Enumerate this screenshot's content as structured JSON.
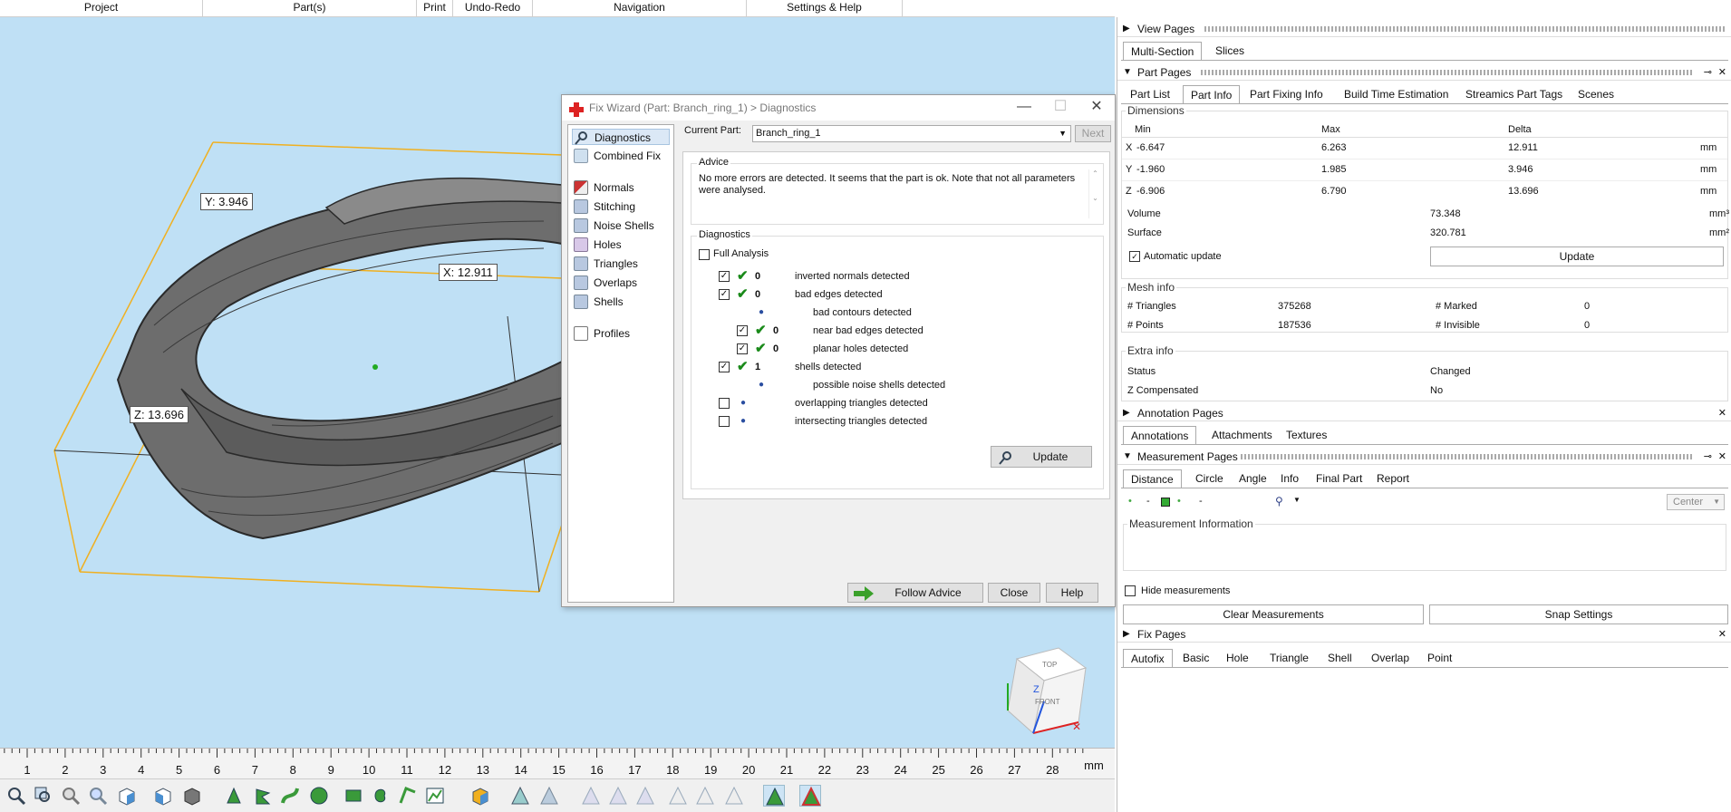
{
  "menubar": [
    "Project",
    "Part(s)",
    "Print",
    "Undo-Redo",
    "Navigation",
    "Settings & Help"
  ],
  "viewport": {
    "labels": {
      "y": "Y: 3.946",
      "x": "X: 12.911",
      "z": "Z: 13.696"
    },
    "cube": {
      "top": "TOP",
      "front": "FRONT",
      "axis": "Z"
    }
  },
  "ruler": {
    "ticks": [
      "1",
      "2",
      "3",
      "4",
      "5",
      "6",
      "7",
      "8",
      "9",
      "10",
      "11",
      "12",
      "13",
      "14",
      "15",
      "16",
      "17",
      "18",
      "19",
      "20",
      "21",
      "22",
      "23",
      "24",
      "25",
      "26",
      "27",
      "28"
    ],
    "unit": "mm"
  },
  "dialog": {
    "title": "Fix Wizard (Part: Branch_ring_1) > Diagnostics",
    "nav": {
      "diagnostics": "Diagnostics",
      "combined_fix": "Combined Fix",
      "normals": "Normals",
      "stitching": "Stitching",
      "noise_shells": "Noise Shells",
      "holes": "Holes",
      "triangles": "Triangles",
      "overlaps": "Overlaps",
      "shells": "Shells",
      "profiles": "Profiles"
    },
    "current_part_label": "Current Part:",
    "current_part_value": "Branch_ring_1",
    "next_button": "Next",
    "advice_title": "Advice",
    "advice_text": "No more errors are detected. It seems that the part is ok. Note that not all parameters were analysed.",
    "diagnostics_title": "Diagnostics",
    "full_analysis": "Full Analysis",
    "rows": {
      "inverted_normals": {
        "count": "0",
        "label": "inverted normals detected"
      },
      "bad_edges": {
        "count": "0",
        "label": "bad edges detected"
      },
      "bad_contours": {
        "label": "bad contours detected"
      },
      "near_bad_edges": {
        "count": "0",
        "label": "near bad edges detected"
      },
      "planar_holes": {
        "count": "0",
        "label": "planar holes detected"
      },
      "shells": {
        "count": "1",
        "label": "shells detected"
      },
      "noise_shells": {
        "label": "possible noise shells detected"
      },
      "overlapping": {
        "label": "overlapping triangles detected"
      },
      "intersecting": {
        "label": "intersecting triangles detected"
      }
    },
    "update_button": "Update",
    "follow_advice_button": "Follow Advice",
    "close_button": "Close",
    "help_button": "Help"
  },
  "panel": {
    "view_pages": {
      "title": "View Pages",
      "tabs": [
        "Multi-Section",
        "Slices"
      ]
    },
    "part_pages": {
      "title": "Part Pages",
      "tabs": [
        "Part List",
        "Part Info",
        "Part Fixing Info",
        "Build Time Estimation",
        "Streamics Part Tags",
        "Scenes"
      ]
    },
    "dimensions": {
      "title": "Dimensions",
      "headers": [
        "Min",
        "Max",
        "Delta"
      ],
      "x": {
        "axis": "X",
        "min": "-6.647",
        "max": "6.263",
        "delta": "12.911",
        "unit": "mm"
      },
      "y": {
        "axis": "Y",
        "min": "-1.960",
        "max": "1.985",
        "delta": "3.946",
        "unit": "mm"
      },
      "z": {
        "axis": "Z",
        "min": "-6.906",
        "max": "6.790",
        "delta": "13.696",
        "unit": "mm"
      },
      "volume": {
        "label": "Volume",
        "value": "73.348",
        "unit": "mm³"
      },
      "surface": {
        "label": "Surface",
        "value": "320.781",
        "unit": "mm²"
      },
      "automatic_update": "Automatic update",
      "update_button": "Update"
    },
    "mesh_info": {
      "title": "Mesh info",
      "triangles_label": "# Triangles",
      "triangles": "375268",
      "marked_label": "# Marked",
      "marked": "0",
      "points_label": "# Points",
      "points": "187536",
      "invisible_label": "# Invisible",
      "invisible": "0"
    },
    "extra_info": {
      "title": "Extra info",
      "status_label": "Status",
      "status": "Changed",
      "zcomp_label": "Z Compensated",
      "zcomp": "No"
    },
    "annotation_pages": {
      "title": "Annotation Pages",
      "tabs": [
        "Annotations",
        "Attachments",
        "Textures"
      ]
    },
    "measurement_pages": {
      "title": "Measurement Pages",
      "tabs": [
        "Distance",
        "Circle",
        "Angle",
        "Info",
        "Final Part",
        "Report"
      ],
      "center_select": "Center",
      "info_title": "Measurement Information",
      "hide_measurements": "Hide measurements",
      "clear_button": "Clear Measurements",
      "snap_button": "Snap Settings"
    },
    "fix_pages": {
      "title": "Fix Pages",
      "tabs": [
        "Autofix",
        "Basic",
        "Hole",
        "Triangle",
        "Shell",
        "Overlap",
        "Point"
      ]
    }
  },
  "colors": {
    "viewport_bg": "#bfe0f5",
    "bbox": "#f0b020",
    "check": "#1a8a1a",
    "follow_arrow": "#3aa02a"
  }
}
